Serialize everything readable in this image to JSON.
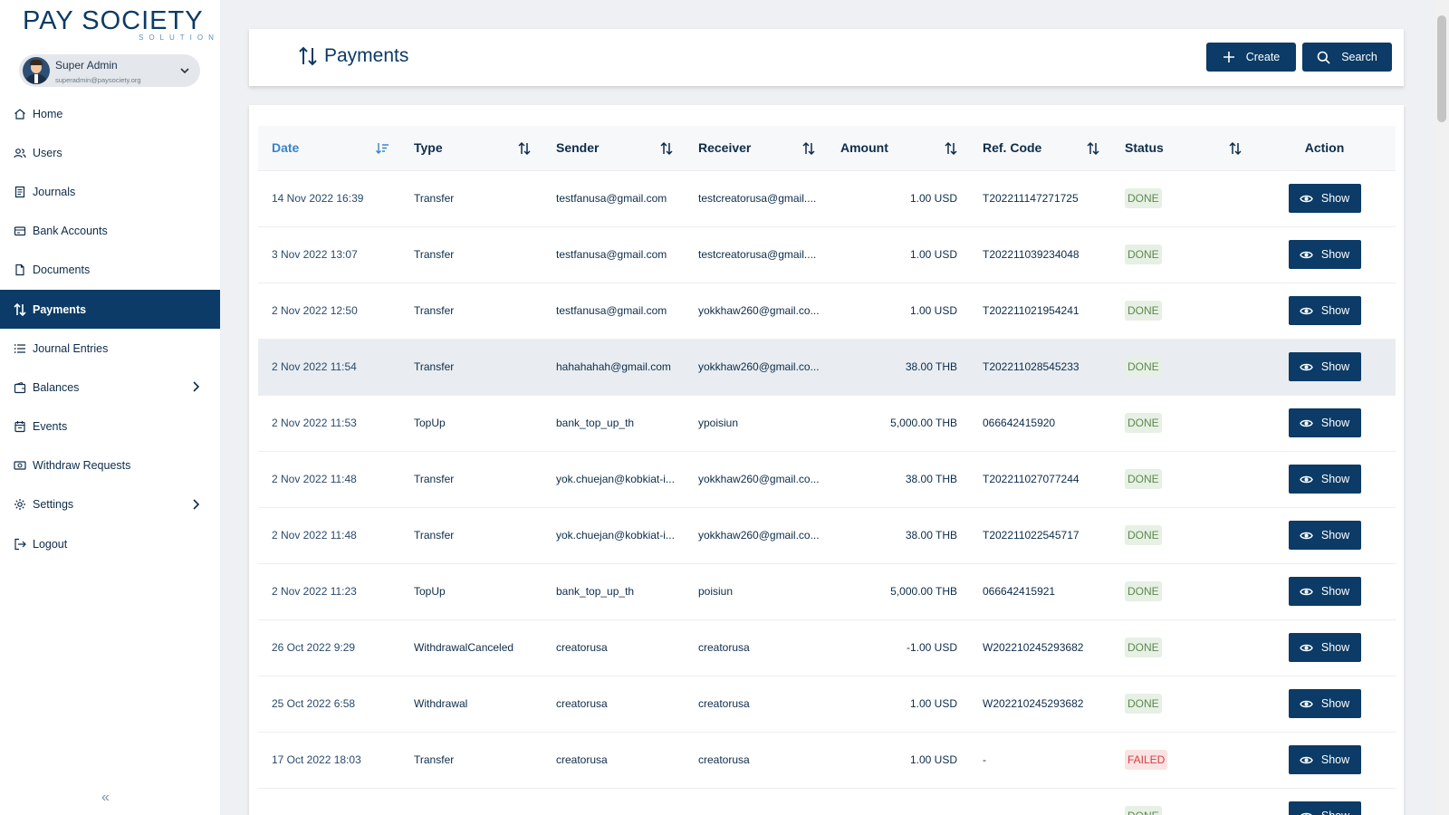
{
  "brand": {
    "name_part1": "PAY",
    "name_part2": "SOCIETY",
    "tagline": "SOLUTION"
  },
  "user": {
    "name": "Super Admin",
    "email": "superadmin@paysociety.org"
  },
  "nav": [
    {
      "label": "Home",
      "icon": "home-icon"
    },
    {
      "label": "Users",
      "icon": "users-icon"
    },
    {
      "label": "Journals",
      "icon": "journal-icon"
    },
    {
      "label": "Bank Accounts",
      "icon": "bank-icon"
    },
    {
      "label": "Documents",
      "icon": "document-icon"
    },
    {
      "label": "Payments",
      "icon": "swap-icon",
      "active": true
    },
    {
      "label": "Journal Entries",
      "icon": "list-icon"
    },
    {
      "label": "Balances",
      "icon": "wallet-icon",
      "has_children": true
    },
    {
      "label": "Events",
      "icon": "calendar-icon"
    },
    {
      "label": "Withdraw Requests",
      "icon": "cash-icon"
    },
    {
      "label": "Settings",
      "icon": "gear-icon",
      "has_children": true
    },
    {
      "label": "Logout",
      "icon": "logout-icon"
    }
  ],
  "collapse_glyph": "«",
  "page": {
    "title": "Payments"
  },
  "actions": {
    "create_label": "Create",
    "search_label": "Search"
  },
  "colors": {
    "primary": "#0b3b66",
    "accent": "#3a84c6",
    "done_bg": "#e6f0e4",
    "done_text": "#5d8a4d",
    "failed_bg": "#fbe3e3",
    "failed_text": "#d14040"
  },
  "table": {
    "columns": [
      "Date",
      "Type",
      "Sender",
      "Receiver",
      "Amount",
      "Ref. Code",
      "Status",
      "Action"
    ],
    "show_label": "Show",
    "rows": [
      {
        "date": "14 Nov 2022 16:39",
        "type": "Transfer",
        "sender": "testfanusa@gmail.com",
        "receiver": "testcreatorusa@gmail....",
        "amount": "1.00 USD",
        "ref": "T202211147271725",
        "status": "DONE"
      },
      {
        "date": "3 Nov 2022 13:07",
        "type": "Transfer",
        "sender": "testfanusa@gmail.com",
        "receiver": "testcreatorusa@gmail....",
        "amount": "1.00 USD",
        "ref": "T202211039234048",
        "status": "DONE"
      },
      {
        "date": "2 Nov 2022 12:50",
        "type": "Transfer",
        "sender": "testfanusa@gmail.com",
        "receiver": "yokkhaw260@gmail.co...",
        "amount": "1.00 USD",
        "ref": "T202211021954241",
        "status": "DONE"
      },
      {
        "date": "2 Nov 2022 11:54",
        "type": "Transfer",
        "sender": "hahahahah@gmail.com",
        "receiver": "yokkhaw260@gmail.co...",
        "amount": "38.00 THB",
        "ref": "T202211028545233",
        "status": "DONE",
        "highlighted": true
      },
      {
        "date": "2 Nov 2022 11:53",
        "type": "TopUp",
        "sender": "bank_top_up_th",
        "receiver": "ypoisiun",
        "amount": "5,000.00 THB",
        "ref": "066642415920",
        "status": "DONE"
      },
      {
        "date": "2 Nov 2022 11:48",
        "type": "Transfer",
        "sender": "yok.chuejan@kobkiat-i...",
        "receiver": "yokkhaw260@gmail.co...",
        "amount": "38.00 THB",
        "ref": "T202211027077244",
        "status": "DONE"
      },
      {
        "date": "2 Nov 2022 11:48",
        "type": "Transfer",
        "sender": "yok.chuejan@kobkiat-i...",
        "receiver": "yokkhaw260@gmail.co...",
        "amount": "38.00 THB",
        "ref": "T202211022545717",
        "status": "DONE"
      },
      {
        "date": "2 Nov 2022 11:23",
        "type": "TopUp",
        "sender": "bank_top_up_th",
        "receiver": "poisiun",
        "amount": "5,000.00 THB",
        "ref": "066642415921",
        "status": "DONE"
      },
      {
        "date": "26 Oct 2022 9:29",
        "type": "WithdrawalCanceled",
        "sender": "creatorusa",
        "receiver": "creatorusa",
        "amount": "-1.00 USD",
        "ref": "W202210245293682",
        "status": "DONE"
      },
      {
        "date": "25 Oct 2022 6:58",
        "type": "Withdrawal",
        "sender": "creatorusa",
        "receiver": "creatorusa",
        "amount": "1.00 USD",
        "ref": "W202210245293682",
        "status": "DONE"
      },
      {
        "date": "17 Oct 2022 18:03",
        "type": "Transfer",
        "sender": "creatorusa",
        "receiver": "creatorusa",
        "amount": "1.00 USD",
        "ref": "-",
        "status": "FAILED"
      },
      {
        "date": "",
        "type": "",
        "sender": "",
        "receiver": "",
        "amount": "",
        "ref": "",
        "status": "DONE"
      }
    ]
  }
}
